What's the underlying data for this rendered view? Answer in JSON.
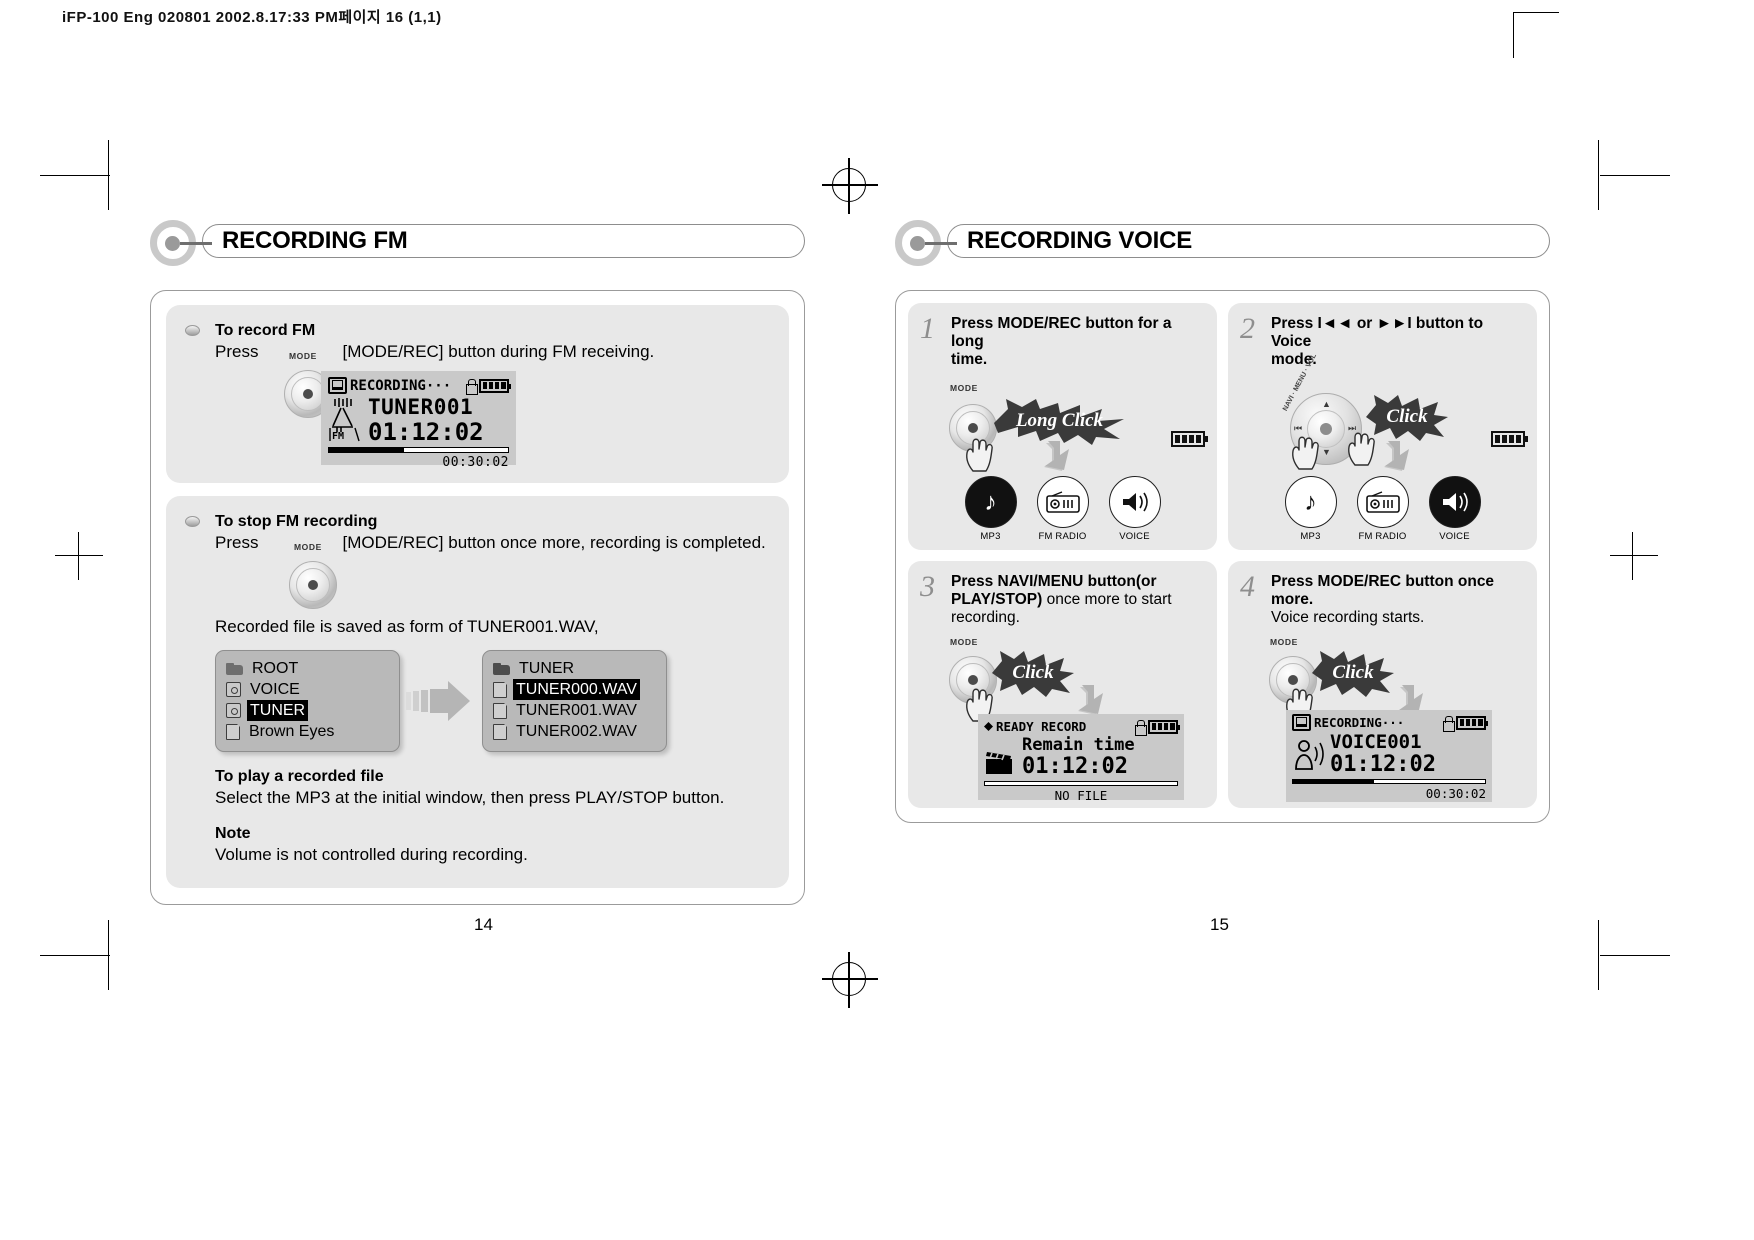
{
  "print_header": "iFP-100 Eng 020801  2002.8.17:33 PM페이지 16 (1,1)",
  "left_page": {
    "banner_title": "RECORDING FM",
    "page_number": "14",
    "block1": {
      "heading": "To record FM",
      "press_label": "Press",
      "knob_label": "MODE",
      "instruction": "[MODE/REC] button during FM receiving.",
      "lcd": {
        "status": "RECORDING···",
        "title": "TUNER001",
        "time": "01:12:02",
        "elapsed": "00:30:02",
        "source_tag": "FM",
        "progress_pct": 42
      }
    },
    "block2": {
      "heading": "To stop FM recording",
      "press_label": "Press",
      "knob_label": "MODE",
      "instruction": "[MODE/REC] button once more, recording is completed.",
      "saved_note": "Recorded file is saved as form of TUNER001.WAV,",
      "browser_left": [
        {
          "icon": "folder-icon",
          "name": "ROOT",
          "selected": false
        },
        {
          "icon": "tag-icon",
          "name": "VOICE",
          "selected": false
        },
        {
          "icon": "tag-icon",
          "name": "TUNER",
          "selected": true
        },
        {
          "icon": "file-icon",
          "name": "Brown Eyes",
          "selected": false
        }
      ],
      "browser_right": [
        {
          "icon": "folder-icon",
          "name": "TUNER",
          "selected": false
        },
        {
          "icon": "file-icon",
          "name": "TUNER000.WAV",
          "selected": true
        },
        {
          "icon": "file-icon",
          "name": "TUNER001.WAV",
          "selected": false
        },
        {
          "icon": "file-icon",
          "name": "TUNER002.WAV",
          "selected": false
        }
      ],
      "play_head": "To play a recorded file",
      "play_text": "Select the MP3 at the initial window, then press PLAY/STOP button.",
      "note_head": "Note",
      "note_text": "Volume is not controlled during recording."
    }
  },
  "right_page": {
    "banner_title": "RECORDING VOICE",
    "page_number": "15",
    "steps": [
      {
        "number": "1",
        "text_bold": "Press MODE/REC button for a long",
        "text_rest": "time.",
        "knob_label": "MODE",
        "burst": "Long Click",
        "mode_icons": [
          {
            "label": "MP3",
            "glyph": "♫",
            "active": true
          },
          {
            "label": "FM RADIO",
            "glyph": "radio-icon",
            "active": false
          },
          {
            "label": "VOICE",
            "glyph": "voice-icon",
            "active": false
          }
        ]
      },
      {
        "number": "2",
        "text_bold": "Press I◄◄ or ►►I button to Voice",
        "text_rest": "mode.",
        "pad_label_top": "NAVI · MENU · VOL",
        "burst": "Click",
        "mode_icons": [
          {
            "label": "MP3",
            "glyph": "♫",
            "active": false
          },
          {
            "label": "FM RADIO",
            "glyph": "radio-icon",
            "active": false
          },
          {
            "label": "VOICE",
            "glyph": "voice-icon",
            "active": true
          }
        ]
      },
      {
        "number": "3",
        "text_bold": "Press NAVI/MENU button(or",
        "text_bold2": "PLAY/STOP)",
        "text_rest": " once more to start",
        "text_rest2": "recording.",
        "knob_label": "MODE",
        "burst": "Click",
        "lcd": {
          "status": "READY RECORD",
          "line2": "Remain time",
          "time": "01:12:02",
          "footer": "NO FILE",
          "progress_pct": 0
        }
      },
      {
        "number": "4",
        "text_bold": "Press MODE/REC button once more.",
        "text_rest": "Voice recording starts.",
        "knob_label": "MODE",
        "burst": "Click",
        "lcd": {
          "status": "RECORDING···",
          "title": "VOICE001",
          "time": "01:12:02",
          "footer": "00:30:02",
          "progress_pct": 42
        }
      }
    ]
  }
}
